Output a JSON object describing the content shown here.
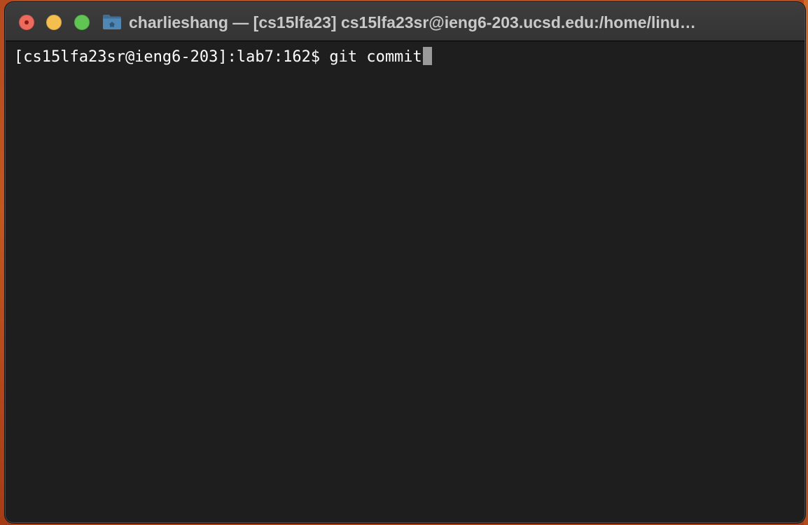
{
  "window": {
    "title": "charlieshang — [cs15lfa23]  cs15lfa23sr@ieng6-203.ucsd.edu:/home/linu…"
  },
  "titlebar": {
    "buttons": [
      {
        "name": "close",
        "color": "#ed6a5e"
      },
      {
        "name": "minimize",
        "color": "#f5bf4f"
      },
      {
        "name": "maximize",
        "color": "#61c554"
      }
    ],
    "icon": "folder-home-icon"
  },
  "terminal": {
    "background": "#1e1e1e",
    "foreground": "#ffffff",
    "lines": [
      {
        "prompt": "[cs15lfa23sr@ieng6-203]:lab7:162$ ",
        "command": "git commit"
      }
    ]
  }
}
